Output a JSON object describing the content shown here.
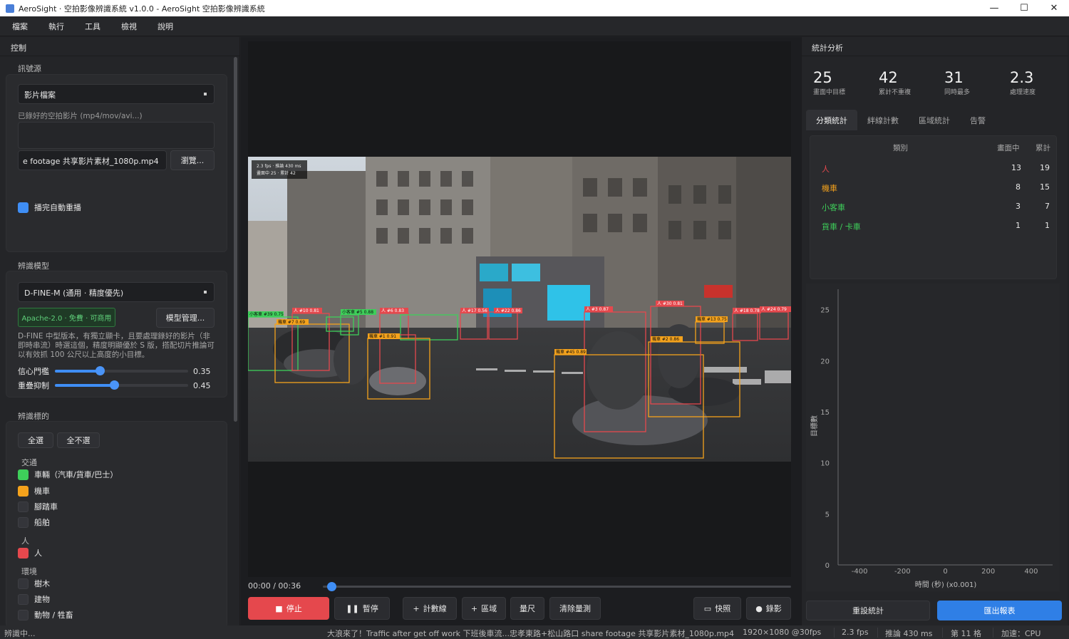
{
  "window": {
    "title": "AeroSight · 空拍影像辨識系統  v1.0.0 - AeroSight 空拍影像辨識系統",
    "minimize": "—",
    "maximize": "☐",
    "close": "✕"
  },
  "menu": [
    "檔案",
    "執行",
    "工具",
    "檢視",
    "說明"
  ],
  "left": {
    "header": "控制",
    "source": {
      "group_label": "訊號源",
      "type": "影片檔案",
      "hint": "已錄好的空拍影片 (mp4/mov/avi...)",
      "file": "e footage 共享影片素材_1080p.mp4",
      "browse": "瀏覽...",
      "autoplay_label": "播完自動重播",
      "autoplay_checked": true
    },
    "model": {
      "group_label": "辨識模型",
      "name": "D-FINE-M (通用 · 精度優先)",
      "license": "Apache-2.0 · 免費 · 可商用",
      "manage": "模型管理...",
      "description": "D-FINE 中型版本，有獨立顯卡，且要處理錄好的影片（非即時串流）時選這個，精度明顯優於 S 版，搭配切片推論可以有效抓 100 公尺以上高度的小目標。",
      "conf_label": "信心門檻",
      "conf_value": "0.35",
      "conf": 0.35,
      "nms_label": "重疊抑制",
      "nms_value": "0.45",
      "nms": 0.45
    },
    "targets": {
      "group_label": "辨識標的",
      "select_all": "全選",
      "select_none": "全不選",
      "categories": [
        {
          "head": "交通",
          "items": [
            {
              "label": "車輛（汽車/貨車/巴士）",
              "color": "#3ecf5a",
              "checked": true
            },
            {
              "label": "機車",
              "color": "#f4a21c",
              "checked": true
            },
            {
              "label": "腳踏車",
              "color": "",
              "checked": false
            },
            {
              "label": "船舶",
              "color": "",
              "checked": false
            }
          ]
        },
        {
          "head": "人",
          "items": [
            {
              "label": "人",
              "color": "#e5484d",
              "checked": true
            }
          ]
        },
        {
          "head": "環境",
          "items": [
            {
              "label": "樹木",
              "color": "",
              "checked": false
            },
            {
              "label": "建物",
              "color": "",
              "checked": false
            },
            {
              "label": "動物 / 牲畜",
              "color": "",
              "checked": false
            }
          ]
        }
      ]
    }
  },
  "video": {
    "overlay_line1": "2.3 fps · 推論 430 ms",
    "overlay_line2": "畫面中 25 · 累計 42",
    "detections": [
      {
        "cls": "car",
        "label": "小客車 #39 0.75"
      },
      {
        "cls": "person",
        "label": "人 #10 0.81"
      },
      {
        "cls": "car",
        "label": "小客車 #5 0.88"
      },
      {
        "cls": "person",
        "label": "人 #6 0.83"
      },
      {
        "cls": "motor",
        "label": "機車 #1 0.91"
      },
      {
        "cls": "person",
        "label": "人 #17 0.56"
      },
      {
        "cls": "person",
        "label": "人 #22 0.86"
      },
      {
        "cls": "person",
        "label": "人 #3 0.87"
      },
      {
        "cls": "person",
        "label": "人 #30 0.81"
      },
      {
        "cls": "person",
        "label": "人 #18 0.78"
      },
      {
        "cls": "person",
        "label": "人 #24 0.79"
      },
      {
        "cls": "motor",
        "label": "機車 #45 0.89"
      },
      {
        "cls": "motor",
        "label": "機車 #2 0.86"
      },
      {
        "cls": "motor",
        "label": "機車 #7 0.69"
      },
      {
        "cls": "motor",
        "label": "機車 #13 0.75"
      }
    ],
    "time": "00:00 / 00:36",
    "progress": 0.005
  },
  "controls": {
    "stop": "停止",
    "pause": "暫停",
    "count_line": "計數線",
    "zone": "區域",
    "ruler": "量尺",
    "clear_measure": "清除量測",
    "snapshot": "快照",
    "record": "錄影"
  },
  "right": {
    "header": "統計分析",
    "kpis": [
      {
        "value": "25",
        "label": "畫面中目標"
      },
      {
        "value": "42",
        "label": "累計不重複"
      },
      {
        "value": "31",
        "label": "同時最多"
      },
      {
        "value": "2.3",
        "label": "處理速度"
      }
    ],
    "tabs": [
      "分類統計",
      "絆線計數",
      "區域統計",
      "告警"
    ],
    "table": {
      "headers": [
        "類別",
        "畫面中",
        "累計"
      ],
      "rows": [
        {
          "name": "人",
          "color": "#e5484d",
          "current": "13",
          "total": "19"
        },
        {
          "name": "機車",
          "color": "#f4a21c",
          "current": "8",
          "total": "15"
        },
        {
          "name": "小客車",
          "color": "#3ecf5a",
          "current": "3",
          "total": "7"
        },
        {
          "name": "貨車 / 卡車",
          "color": "#3ecf5a",
          "current": "1",
          "total": "1"
        }
      ]
    },
    "reset": "重設統計",
    "export": "匯出報表"
  },
  "chart_data": {
    "type": "line",
    "title": "",
    "xlabel": "時間 (秒) (x0.001)",
    "ylabel": "目標數",
    "xlim": [
      -500,
      500
    ],
    "ylim": [
      0,
      27
    ],
    "x_ticks": [
      "-400",
      "-200",
      "0",
      "200",
      "400"
    ],
    "y_ticks": [
      "0",
      "5",
      "10",
      "15",
      "20",
      "25"
    ],
    "series": []
  },
  "status": {
    "state": "辨識中...",
    "source": "大浪來了！Traffic after get off work 下班後車流...忠孝東路+松山路口 share footage 共享影片素材_1080p.mp4",
    "resolution": "1920×1080 @30fps",
    "fps": "2.3 fps",
    "inference": "推論 430 ms",
    "frame": "第 11 格",
    "accel": "加速：CPU"
  },
  "colors": {
    "accent": "#3f8ef5",
    "stop": "#e5484d",
    "person": "#e5484d",
    "motor": "#f4a21c",
    "car": "#3ecf5a"
  }
}
